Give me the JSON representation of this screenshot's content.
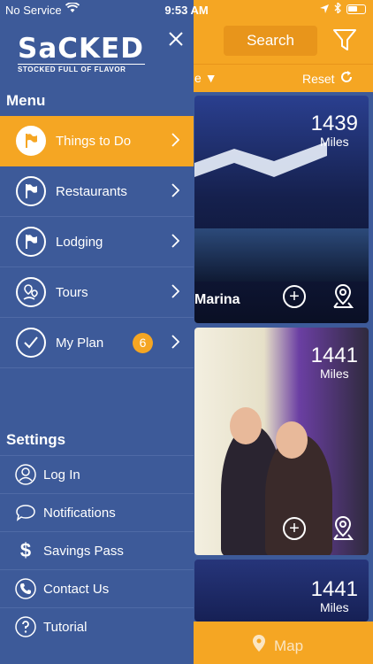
{
  "status": {
    "carrier": "No Service",
    "time": "9:53 AM"
  },
  "drawer": {
    "logo": {
      "word": "SaCKED",
      "tagline": "STOCKED FULL OF FLAVOR"
    },
    "menu_heading": "Menu",
    "menu_items": [
      {
        "label": "Things to Do",
        "icon": "flag-icon",
        "active": true
      },
      {
        "label": "Restaurants",
        "icon": "flag-icon"
      },
      {
        "label": "Lodging",
        "icon": "flag-icon"
      },
      {
        "label": "Tours",
        "icon": "map-pin-route-icon"
      },
      {
        "label": "My Plan",
        "icon": "checkmark-icon",
        "badge": "6"
      }
    ],
    "settings_heading": "Settings",
    "settings_items": [
      {
        "label": "Log In",
        "icon": "user-icon"
      },
      {
        "label": "Notifications",
        "icon": "chat-bubble-icon"
      },
      {
        "label": "Savings Pass",
        "icon": "dollar-icon"
      },
      {
        "label": "Contact Us",
        "icon": "phone-icon"
      },
      {
        "label": "Tutorial",
        "icon": "question-icon"
      }
    ]
  },
  "toolbar": {
    "search_label": "Search",
    "sort_fragment": "e",
    "reset_label": "Reset"
  },
  "cards": [
    {
      "miles": "1439",
      "unit": "Miles",
      "title": "Marina"
    },
    {
      "miles": "1441",
      "unit": "Miles",
      "title": ""
    },
    {
      "miles": "1441",
      "unit": "Miles",
      "title": ""
    }
  ],
  "map_label": "Map",
  "colors": {
    "drawer": "#3d5a99",
    "accent": "#f5a623"
  }
}
